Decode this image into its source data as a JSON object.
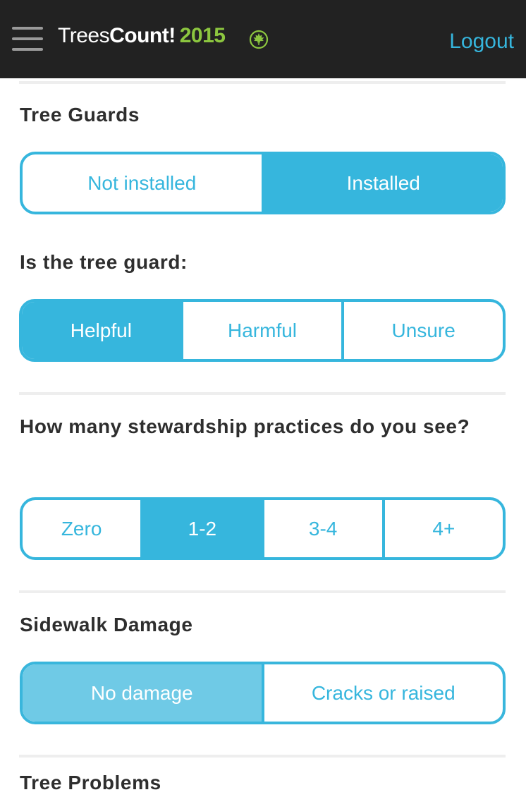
{
  "header": {
    "brand_part1": "Trees",
    "brand_part2": "Count!",
    "brand_year": "2015",
    "logout_label": "Logout"
  },
  "sections": {
    "tree_guards": {
      "title": "Tree Guards",
      "options": [
        "Not installed",
        "Installed"
      ],
      "selected": "Installed"
    },
    "guard_quality": {
      "title": "Is the tree guard:",
      "options": [
        "Helpful",
        "Harmful",
        "Unsure"
      ],
      "selected": "Helpful"
    },
    "stewardship": {
      "title": "How many stewardship practices do you see?",
      "options": [
        "Zero",
        "1-2",
        "3-4",
        "4+"
      ],
      "selected": "1-2"
    },
    "sidewalk": {
      "title": "Sidewalk Damage",
      "options": [
        "No damage",
        "Cracks or raised"
      ],
      "selected": "No damage"
    },
    "tree_problems": {
      "title": "Tree Problems"
    }
  },
  "colors": {
    "accent": "#36b6dd",
    "accent_light": "#6fcae6",
    "brand_green": "#8cc63f",
    "topbar": "#222222"
  },
  "icons": [
    "hamburger-menu-icon",
    "maple-leaf-icon"
  ]
}
